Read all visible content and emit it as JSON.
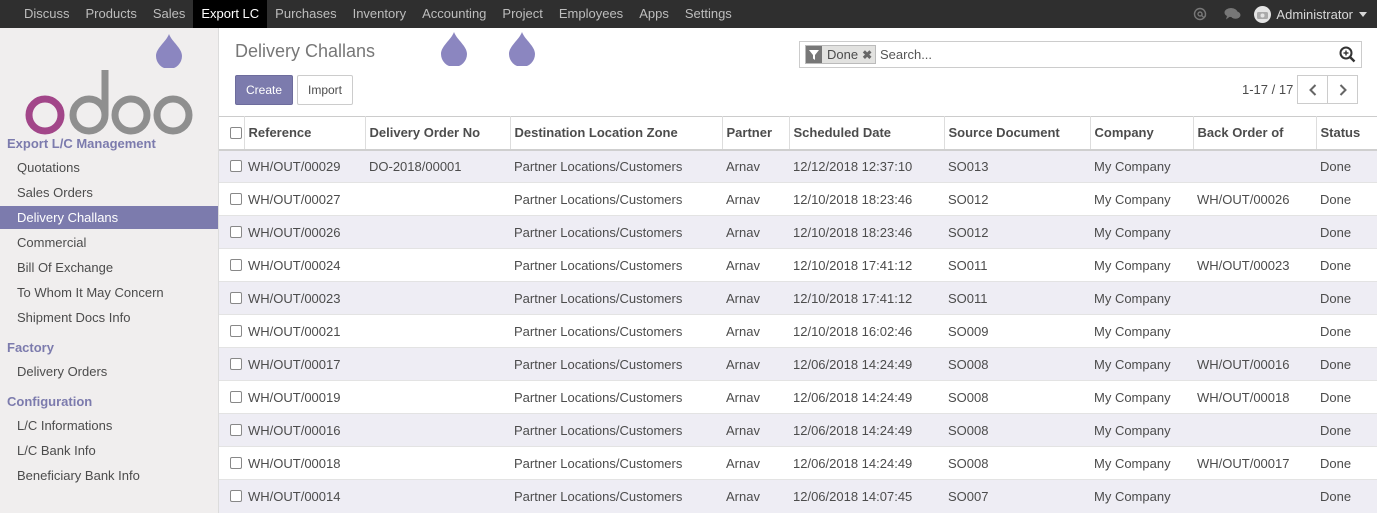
{
  "topnav": {
    "items": [
      "Discuss",
      "Products",
      "Sales",
      "Export LC",
      "Purchases",
      "Inventory",
      "Accounting",
      "Project",
      "Employees",
      "Apps",
      "Settings"
    ],
    "active": "Export LC",
    "user": "Administrator"
  },
  "sidebar": {
    "logo_text": "odoo",
    "sections": [
      {
        "title": "Export L/C Management",
        "items": [
          "Quotations",
          "Sales Orders",
          "Delivery Challans",
          "Commercial",
          "Bill Of Exchange",
          "To Whom It May Concern",
          "Shipment Docs Info"
        ]
      },
      {
        "title": "Factory",
        "items": [
          "Delivery Orders"
        ]
      },
      {
        "title": "Configuration",
        "items": [
          "L/C Informations",
          "L/C Bank Info",
          "Beneficiary Bank Info"
        ]
      }
    ],
    "active_item": "Delivery Challans"
  },
  "page": {
    "title": "Delivery Challans",
    "create_label": "Create",
    "import_label": "Import"
  },
  "search": {
    "facet_label": "Done",
    "placeholder": "Search..."
  },
  "pager": {
    "value": "1-17 / 17"
  },
  "colors": {
    "accent": "#7c7bad",
    "topbar": "#2f2f2f",
    "row_alt": "#eeedf4"
  },
  "table": {
    "columns": [
      "Reference",
      "Delivery Order No",
      "Destination Location Zone",
      "Partner",
      "Scheduled Date",
      "Source Document",
      "Company",
      "Back Order of",
      "Status"
    ],
    "rows": [
      [
        "WH/OUT/00029",
        "DO-2018/00001",
        "Partner Locations/Customers",
        "Arnav",
        "12/12/2018 12:37:10",
        "SO013",
        "My Company",
        "",
        "Done"
      ],
      [
        "WH/OUT/00027",
        "",
        "Partner Locations/Customers",
        "Arnav",
        "12/10/2018 18:23:46",
        "SO012",
        "My Company",
        "WH/OUT/00026",
        "Done"
      ],
      [
        "WH/OUT/00026",
        "",
        "Partner Locations/Customers",
        "Arnav",
        "12/10/2018 18:23:46",
        "SO012",
        "My Company",
        "",
        "Done"
      ],
      [
        "WH/OUT/00024",
        "",
        "Partner Locations/Customers",
        "Arnav",
        "12/10/2018 17:41:12",
        "SO011",
        "My Company",
        "WH/OUT/00023",
        "Done"
      ],
      [
        "WH/OUT/00023",
        "",
        "Partner Locations/Customers",
        "Arnav",
        "12/10/2018 17:41:12",
        "SO011",
        "My Company",
        "",
        "Done"
      ],
      [
        "WH/OUT/00021",
        "",
        "Partner Locations/Customers",
        "Arnav",
        "12/10/2018 16:02:46",
        "SO009",
        "My Company",
        "",
        "Done"
      ],
      [
        "WH/OUT/00017",
        "",
        "Partner Locations/Customers",
        "Arnav",
        "12/06/2018 14:24:49",
        "SO008",
        "My Company",
        "WH/OUT/00016",
        "Done"
      ],
      [
        "WH/OUT/00019",
        "",
        "Partner Locations/Customers",
        "Arnav",
        "12/06/2018 14:24:49",
        "SO008",
        "My Company",
        "WH/OUT/00018",
        "Done"
      ],
      [
        "WH/OUT/00016",
        "",
        "Partner Locations/Customers",
        "Arnav",
        "12/06/2018 14:24:49",
        "SO008",
        "My Company",
        "",
        "Done"
      ],
      [
        "WH/OUT/00018",
        "",
        "Partner Locations/Customers",
        "Arnav",
        "12/06/2018 14:24:49",
        "SO008",
        "My Company",
        "WH/OUT/00017",
        "Done"
      ],
      [
        "WH/OUT/00014",
        "",
        "Partner Locations/Customers",
        "Arnav",
        "12/06/2018 14:07:45",
        "SO007",
        "My Company",
        "",
        "Done"
      ]
    ]
  }
}
